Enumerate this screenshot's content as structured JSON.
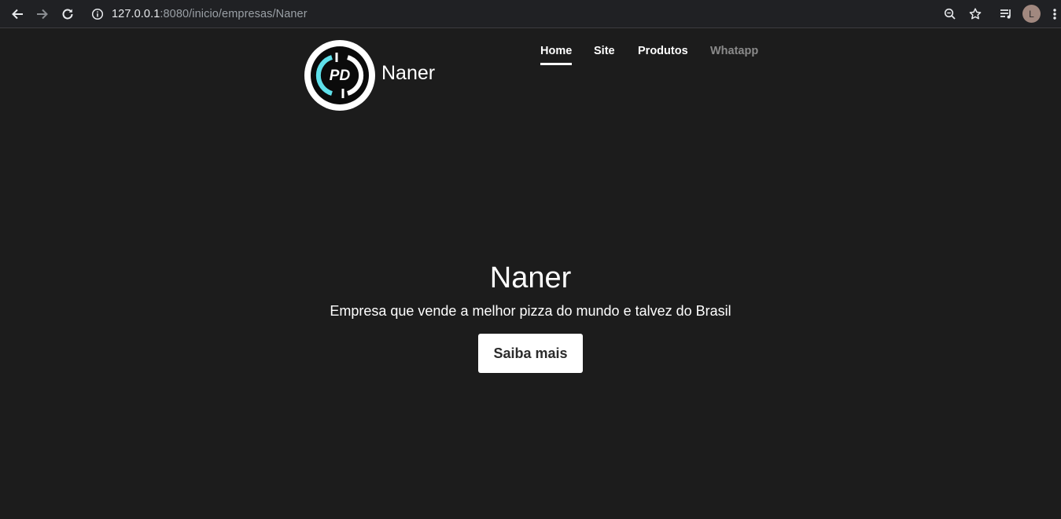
{
  "browser": {
    "url_host": "127.0.0.1",
    "url_path": ":8080/inicio/empresas/Naner",
    "avatar_letter": "L",
    "icons": [
      "back-arrow-icon",
      "forward-arrow-icon",
      "reload-icon",
      "info-icon",
      "zoom-icon",
      "star-icon",
      "media-queue-icon",
      "kebab-menu-icon"
    ]
  },
  "header": {
    "logo_text": "PD",
    "brand": "Naner",
    "nav": [
      {
        "label": "Home",
        "active": true
      },
      {
        "label": "Site",
        "active": false
      },
      {
        "label": "Produtos",
        "active": false
      },
      {
        "label": "Whatapp",
        "active": false,
        "muted": true
      }
    ]
  },
  "hero": {
    "title": "Naner",
    "subtitle": "Empresa que vende a melhor pizza do mundo e talvez do Brasil",
    "button": "Saiba mais"
  },
  "colors": {
    "page_bg": "#1c1c1c",
    "chrome_bg": "#202124",
    "logo_accent": "#5ee0ea",
    "muted_link": "#8a8a8a"
  }
}
